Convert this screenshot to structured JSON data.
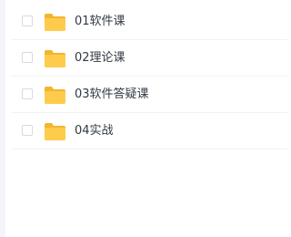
{
  "files": [
    {
      "name": "01软件课",
      "checked": false,
      "icon": "folder-icon"
    },
    {
      "name": "02理论课",
      "checked": false,
      "icon": "folder-icon"
    },
    {
      "name": "03软件答疑课",
      "checked": false,
      "icon": "folder-icon"
    },
    {
      "name": "04实战",
      "checked": false,
      "icon": "folder-icon"
    }
  ],
  "colors": {
    "folder_body": "#FFCB4C",
    "folder_tab": "#F2B530",
    "text": "#333A44"
  }
}
